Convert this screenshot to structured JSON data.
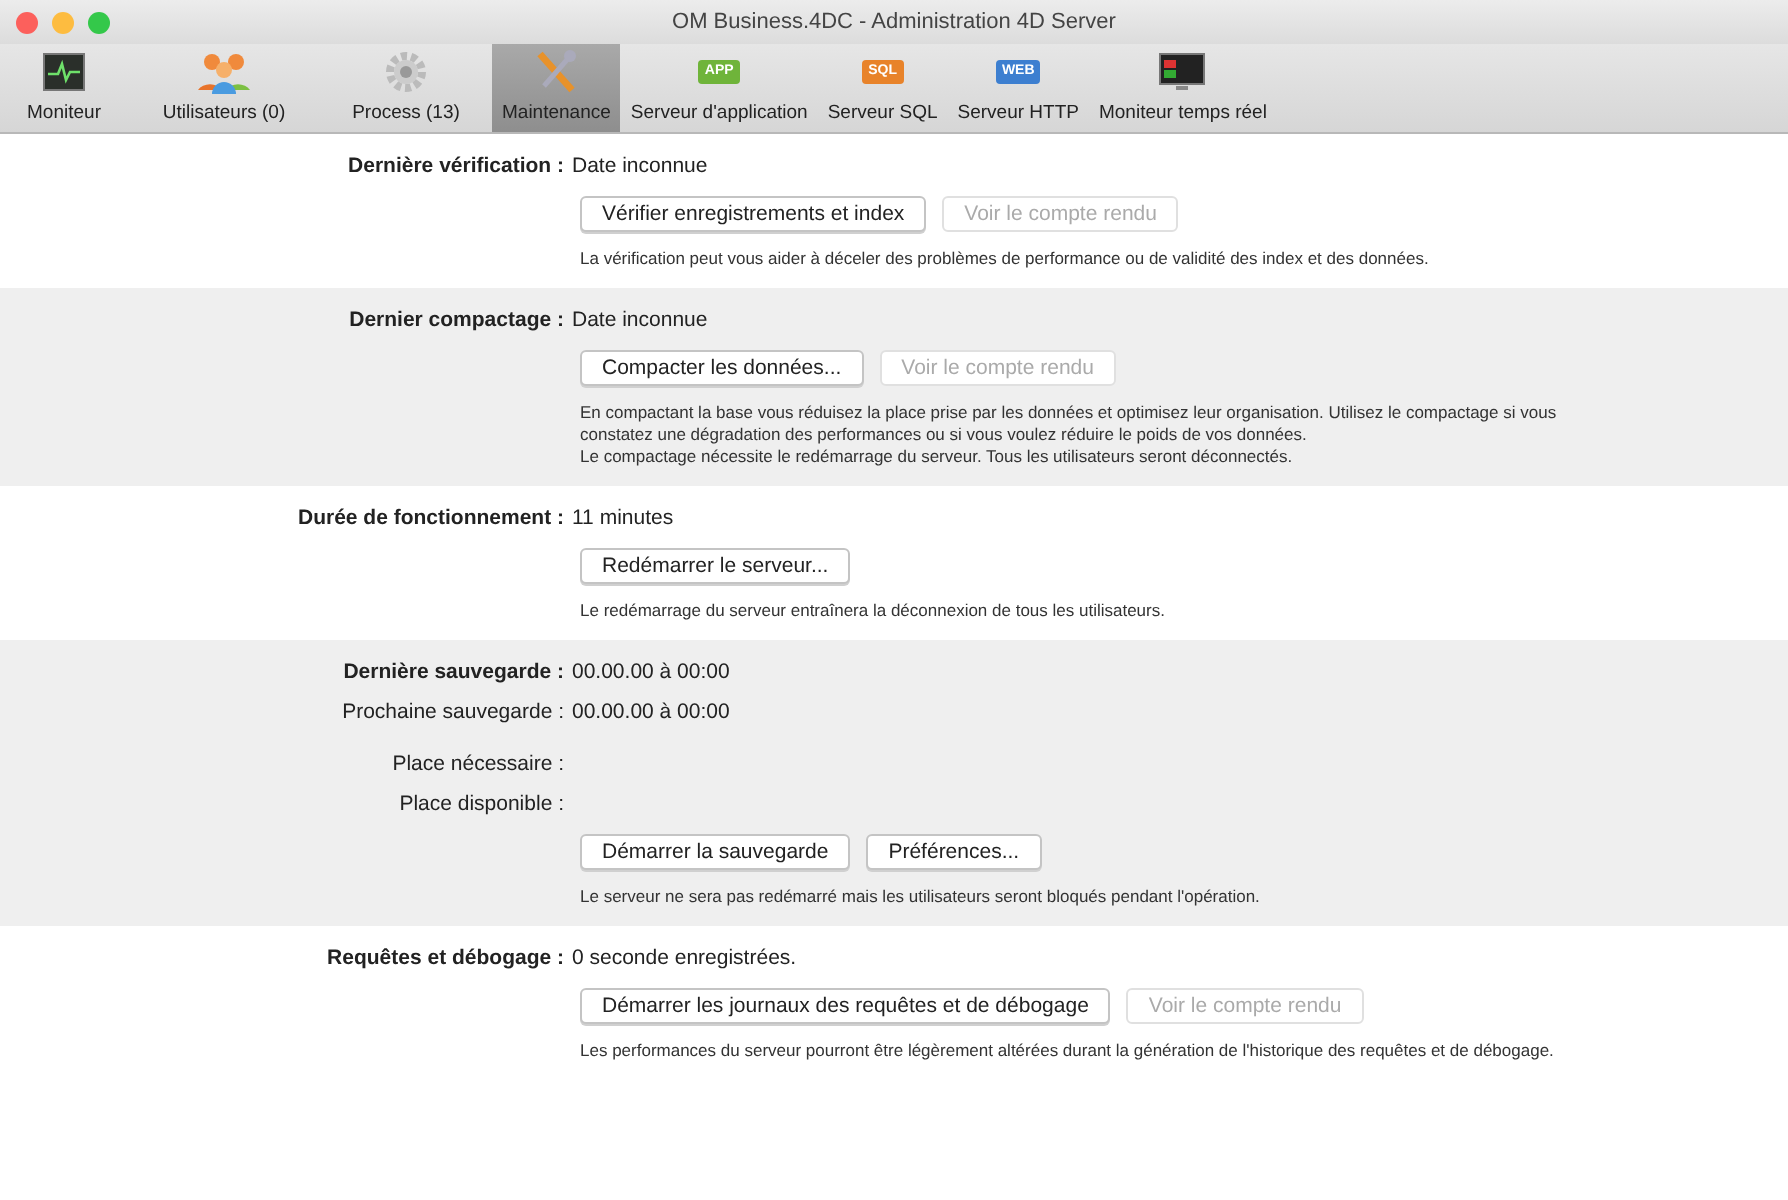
{
  "window": {
    "title": "OM Business.4DC - Administration 4D Server"
  },
  "tabs": [
    {
      "label": "Moniteur",
      "kind": "monitor",
      "selected": false
    },
    {
      "label": "Utilisateurs (0)",
      "kind": "users",
      "selected": false
    },
    {
      "label": "Process (13)",
      "kind": "gear",
      "selected": false
    },
    {
      "label": "Maintenance",
      "kind": "tools",
      "selected": true
    },
    {
      "label": "Serveur d'application",
      "kind": "server",
      "badge": "APP",
      "color": "#6fb43a",
      "selected": false
    },
    {
      "label": "Serveur SQL",
      "kind": "server",
      "badge": "SQL",
      "color": "#e8832a",
      "selected": false
    },
    {
      "label": "Serveur HTTP",
      "kind": "server",
      "badge": "WEB",
      "color": "#3d7fd0",
      "selected": false
    },
    {
      "label": "Moniteur temps réel",
      "kind": "realtime",
      "selected": false
    }
  ],
  "sections": [
    {
      "shaded": false,
      "rows": [
        {
          "label": "Dernière vérification :",
          "bold": true,
          "value": "Date inconnue"
        }
      ],
      "buttons": [
        {
          "label": "Vérifier enregistrements et index",
          "disabled": false
        },
        {
          "label": "Voir le compte rendu",
          "disabled": true
        }
      ],
      "description": "La vérification peut vous aider à déceler des problèmes de performance ou de validité des index et des données."
    },
    {
      "shaded": true,
      "rows": [
        {
          "label": "Dernier compactage :",
          "bold": true,
          "value": "Date inconnue"
        }
      ],
      "buttons": [
        {
          "label": "Compacter les données...",
          "disabled": false
        },
        {
          "label": "Voir le compte rendu",
          "disabled": true
        }
      ],
      "description": "En compactant la base vous réduisez la place prise par les données et optimisez leur organisation. Utilisez le compactage si vous constatez une dégradation des performances ou si vous voulez réduire le poids de vos données.\nLe compactage nécessite le redémarrage du serveur. Tous les utilisateurs seront déconnectés."
    },
    {
      "shaded": false,
      "rows": [
        {
          "label": "Durée de fonctionnement :",
          "bold": true,
          "value": "11 minutes"
        }
      ],
      "buttons": [
        {
          "label": "Redémarrer le serveur...",
          "disabled": false
        }
      ],
      "description": "Le redémarrage du serveur entraînera la déconnexion de tous les utilisateurs."
    },
    {
      "shaded": true,
      "rows": [
        {
          "label": "Dernière sauvegarde :",
          "bold": true,
          "value": "00.00.00 à 00:00"
        },
        {
          "label": "Prochaine sauvegarde :",
          "bold": false,
          "value": "00.00.00 à 00:00"
        },
        {
          "label": "Place nécessaire :",
          "bold": false,
          "kind": "spaced"
        },
        {
          "label": "Place disponible :",
          "bold": false
        }
      ],
      "buttons": [
        {
          "label": "Démarrer la sauvegarde",
          "disabled": false
        },
        {
          "label": "Préférences...",
          "disabled": false
        }
      ],
      "description": "Le serveur ne sera pas redémarré mais les utilisateurs seront bloqués pendant l'opération."
    },
    {
      "shaded": false,
      "rows": [
        {
          "label": "Requêtes et débogage :",
          "bold": true,
          "value": "0 seconde enregistrées."
        }
      ],
      "buttons": [
        {
          "label": "Démarrer les journaux des requêtes et de débogage",
          "disabled": false
        },
        {
          "label": "Voir le compte rendu",
          "disabled": true
        }
      ],
      "description": "Les performances du serveur pourront être légèrement altérées durant la génération de l'historique des requêtes et de débogage."
    }
  ]
}
